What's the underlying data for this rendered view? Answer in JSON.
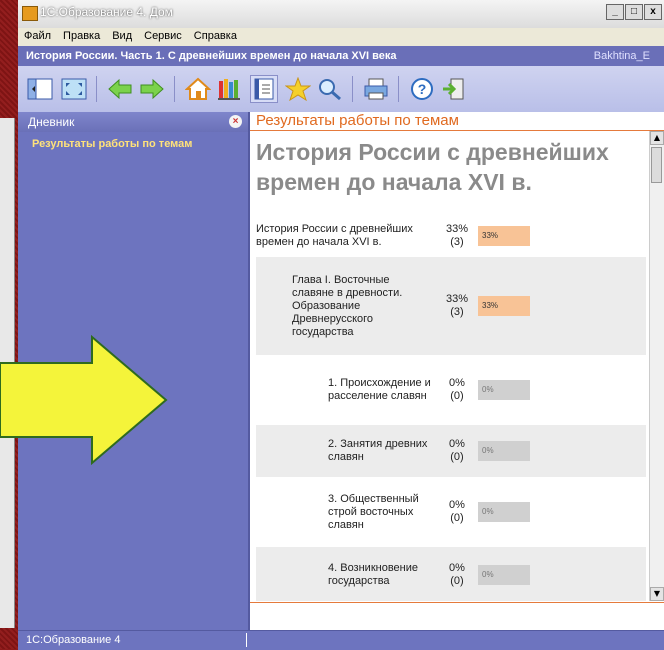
{
  "window": {
    "title": "1С:Образование 4. Дом",
    "controls": [
      "_",
      "□",
      "x"
    ]
  },
  "menu": [
    "Файл",
    "Правка",
    "Вид",
    "Сервис",
    "Справка"
  ],
  "docbar": {
    "title": "История России. Часть 1. С древнейших времен до начала XVI века",
    "user": "Bakhtina_E"
  },
  "toolbar": {
    "icons": [
      "panel-icon",
      "fullscreen-icon",
      "back-arrow-icon",
      "forward-arrow-icon",
      "home-icon",
      "library-icon",
      "notebook-icon",
      "star-icon",
      "search-icon",
      "print-icon",
      "help-icon",
      "exit-icon"
    ],
    "colors": {
      "arrow": "#5cc23a",
      "home": "#f0a030",
      "star": "#f5c518",
      "help": "#2d6cc0"
    }
  },
  "sidebar": {
    "title": "Дневник",
    "items": [
      {
        "label": "Результаты работы по темам"
      }
    ]
  },
  "content": {
    "header": "Результаты работы по темам",
    "heading": "История России с древнейших времен до начала XVI в.",
    "rows": [
      {
        "name": "История России с древнейших времен до начала XVI в.",
        "pct": "33%",
        "count": "(3)",
        "bar": "33%",
        "level": 0,
        "shade": false
      },
      {
        "name": "Глава I. Восточные славяне в древности. Образование Древнерусского государства",
        "pct": "33%",
        "count": "(3)",
        "bar": "33%",
        "level": 1,
        "shade": true
      },
      {
        "name": "1. Происхождение и расселение славян",
        "pct": "0%",
        "count": "(0)",
        "bar": "0%",
        "level": 2,
        "shade": false
      },
      {
        "name": "2. Занятия древних славян",
        "pct": "0%",
        "count": "(0)",
        "bar": "0%",
        "level": 2,
        "shade": true
      },
      {
        "name": "3. Общественный строй восточных славян",
        "pct": "0%",
        "count": "(0)",
        "bar": "0%",
        "level": 2,
        "shade": false
      },
      {
        "name": "4. Возникновение государства",
        "pct": "0%",
        "count": "(0)",
        "bar": "0%",
        "level": 2,
        "shade": true
      }
    ]
  },
  "status": {
    "text": "1С:Образование 4"
  },
  "colors": {
    "accent": "#e06a20",
    "sidebar": "#6d74bf",
    "bar_orange": "#f8c396",
    "bar_gray": "#d0d0d0",
    "arrow": "#f4f43a"
  }
}
